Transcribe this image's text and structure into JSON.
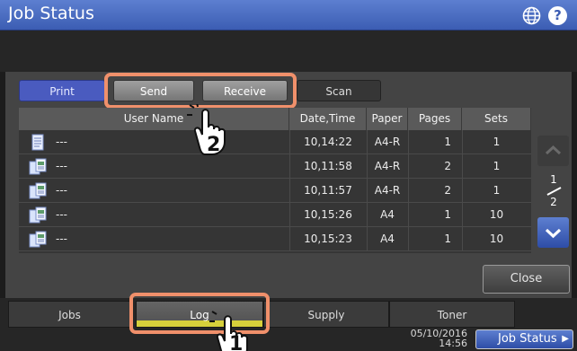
{
  "header": {
    "title": "Job Status",
    "globe_icon": "globe-icon",
    "help_label": "?"
  },
  "tabs": {
    "print": "Print",
    "send": "Send",
    "receive": "Receive",
    "scan": "Scan"
  },
  "table": {
    "columns": [
      "User Name",
      "Date,Time",
      "Paper",
      "Pages",
      "Sets"
    ],
    "rows": [
      {
        "icon": "document-icon",
        "user": "---",
        "date": "10,14:22",
        "paper": "A4-R",
        "pages": "1",
        "sets": "1"
      },
      {
        "icon": "fax-received-icon",
        "user": "---",
        "date": "10,11:58",
        "paper": "A4-R",
        "pages": "2",
        "sets": "1"
      },
      {
        "icon": "fax-received-icon",
        "user": "---",
        "date": "10,11:57",
        "paper": "A4-R",
        "pages": "2",
        "sets": "1"
      },
      {
        "icon": "fax-received-icon",
        "user": "---",
        "date": "10,15:26",
        "paper": "A4",
        "pages": "1",
        "sets": "10"
      },
      {
        "icon": "fax-received-icon",
        "user": "---",
        "date": "10,15:23",
        "paper": "A4",
        "pages": "1",
        "sets": "10"
      }
    ]
  },
  "pager": {
    "current": "1",
    "total": "2"
  },
  "close_label": "Close",
  "bottom_tabs": {
    "jobs": "Jobs",
    "log": "Log",
    "supply": "Supply",
    "toner": "Toner"
  },
  "status": {
    "date": "05/10/2016",
    "time": "14:56",
    "job_status_label": "Job Status"
  },
  "callouts": {
    "step1": "1",
    "step2": "2"
  },
  "colors": {
    "accent": "#3c5db3",
    "highlight": "#f0906b",
    "selected_bar": "#d6d03b"
  }
}
